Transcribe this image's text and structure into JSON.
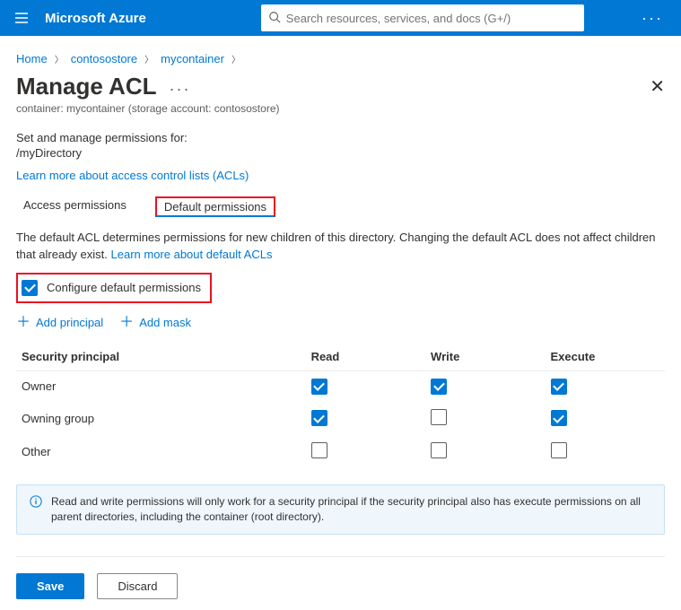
{
  "topbar": {
    "brand": "Microsoft Azure",
    "search_placeholder": "Search resources, services, and docs (G+/)"
  },
  "breadcrumb": {
    "items": [
      "Home",
      "contosostore",
      "mycontainer"
    ]
  },
  "page": {
    "title": "Manage ACL",
    "subtitle": "container: mycontainer (storage account: contosostore)",
    "set_manage_label": "Set and manage permissions for:",
    "path": "/myDirectory",
    "learn_acls": "Learn more about access control lists (ACLs)"
  },
  "tabs": [
    {
      "label": "Access permissions",
      "active": false
    },
    {
      "label": "Default permissions",
      "active": true
    }
  ],
  "default_desc": "The default ACL determines permissions for new children of this directory. Changing the default ACL does not affect children that already exist. ",
  "learn_default": "Learn more about default ACLs",
  "configure_label": "Configure default permissions",
  "configure_checked": true,
  "add_principal": "Add principal",
  "add_mask": "Add mask",
  "table": {
    "headers": {
      "principal": "Security principal",
      "read": "Read",
      "write": "Write",
      "execute": "Execute"
    },
    "rows": [
      {
        "name": "Owner",
        "read": true,
        "write": true,
        "execute": true
      },
      {
        "name": "Owning group",
        "read": true,
        "write": false,
        "execute": true
      },
      {
        "name": "Other",
        "read": false,
        "write": false,
        "execute": false
      }
    ]
  },
  "info_text": "Read and write permissions will only work for a security principal if the security principal also has execute permissions on all parent directories, including the container (root directory).",
  "buttons": {
    "save": "Save",
    "discard": "Discard"
  }
}
